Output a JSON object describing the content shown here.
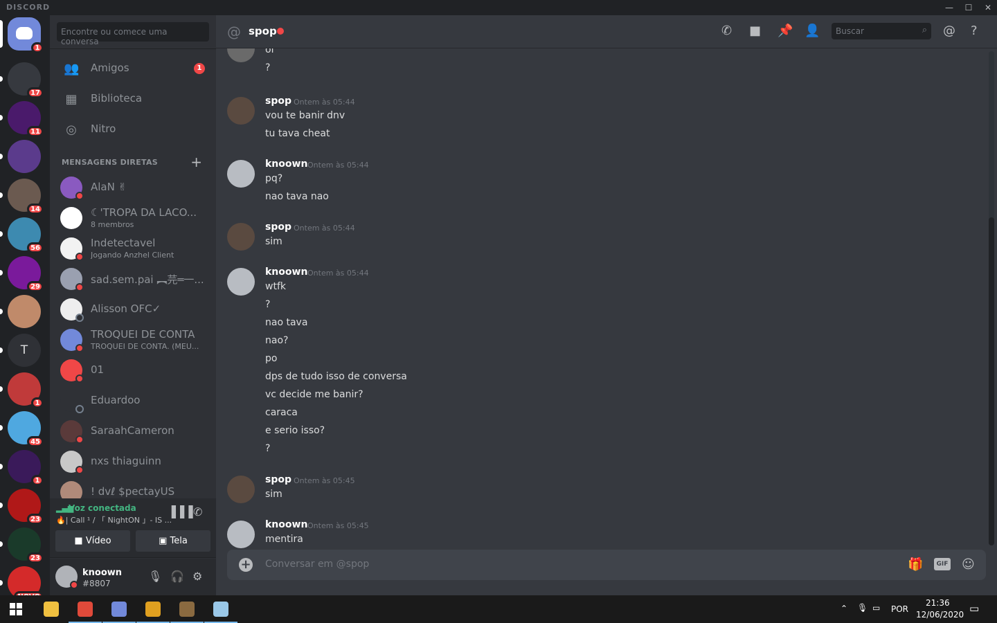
{
  "titlebar": {
    "brand": "DISCORD",
    "minimize": "—",
    "maximize": "☐",
    "close": "✕"
  },
  "guilds": {
    "home_badge": "1",
    "items": [
      {
        "badge": "17",
        "color": "#36393f"
      },
      {
        "badge": "11",
        "color": "#4a1a6b"
      },
      {
        "badge": "",
        "color": "#5b3b8c"
      },
      {
        "badge": "14",
        "color": "#6b5a50"
      },
      {
        "badge": "56",
        "color": "#3d8ab0"
      },
      {
        "badge": "29",
        "color": "#7a1a9b"
      },
      {
        "badge": "",
        "color": "#c08a6a"
      },
      {
        "badge": "",
        "color": "#2f3136",
        "letter": "T"
      },
      {
        "badge": "1",
        "color": "#c03a3a"
      },
      {
        "badge": "45",
        "color": "#4fa8e0"
      },
      {
        "badge": "1",
        "color": "#3a1a5a"
      },
      {
        "badge": "23",
        "color": "#b01818"
      },
      {
        "badge": "23",
        "color": "#1a3a2a"
      },
      {
        "badge": "NOVO",
        "color": "#d42a2a"
      }
    ]
  },
  "dmlist": {
    "search_placeholder": "Encontre ou comece uma conversa",
    "nav": [
      {
        "label": "Amigos",
        "icon": "👥",
        "badge": "1"
      },
      {
        "label": "Biblioteca",
        "icon": "▦",
        "badge": ""
      },
      {
        "label": "Nitro",
        "icon": "◎",
        "badge": ""
      }
    ],
    "header": "MENSAGENS DIRETAS",
    "add": "+",
    "dms": [
      {
        "name": "AlaN ✌",
        "sub": "",
        "color": "#8a5ac0",
        "status": "dnd"
      },
      {
        "name": "☾'TROPA DA LACO...",
        "sub": "8 membros",
        "color": "#ffffff",
        "status": ""
      },
      {
        "name": "Indetectavel",
        "sub": "Jogando Anzhel Client",
        "color": "#f2f2f2",
        "status": "dnd"
      },
      {
        "name": "sad.sem.pai ︻芫═一...",
        "sub": "",
        "color": "#9aa0b0",
        "status": "dnd"
      },
      {
        "name": "Alisson OFC✓",
        "sub": "",
        "color": "#eeeeee",
        "status": "offline"
      },
      {
        "name": "TROQUEI DE CONTA",
        "sub": "TROQUEI DE CONTA. (MEU...",
        "color": "#7289da",
        "status": "dnd"
      },
      {
        "name": "01",
        "sub": "",
        "color": "#f04747",
        "status": "dnd"
      },
      {
        "name": "Eduardoo",
        "sub": "",
        "color": "#2f3136",
        "status": "offline"
      },
      {
        "name": "SaraahCameron",
        "sub": "",
        "color": "#5a3a3a",
        "status": "dnd"
      },
      {
        "name": "nxs thiaguinn",
        "sub": "",
        "color": "#c8c8c8",
        "status": "dnd"
      },
      {
        "name": "! dvℓ $pectayUS",
        "sub": "",
        "color": "#b08a7a",
        "status": ""
      }
    ],
    "voice": {
      "title": "Voz conectada",
      "subtitle": "🔥| Call ¹ / 「 NightON 」- IS ...",
      "video": "Vídeo",
      "screen": "Tela"
    },
    "user": {
      "name": "knoown",
      "tag": "#8807"
    }
  },
  "chat": {
    "channel": "spop",
    "search_placeholder": "Buscar",
    "composer_placeholder": "Conversar em @spop",
    "gif": "GIF",
    "groups": [
      {
        "author": "",
        "time": "",
        "lines": [
          "oi",
          "?"
        ],
        "color": "#6a6a6a"
      },
      {
        "author": "spop",
        "time": "Ontem às 05:44",
        "lines": [
          "vou te banir dnv",
          "tu tava cheat"
        ],
        "color": "#5a4a40"
      },
      {
        "author": "knoown",
        "time": "Ontem às 05:44",
        "lines": [
          "pq?",
          "nao tava nao"
        ],
        "color": "#b8bcc2"
      },
      {
        "author": "spop",
        "time": "Ontem às 05:44",
        "lines": [
          "sim"
        ],
        "color": "#5a4a40"
      },
      {
        "author": "knoown",
        "time": "Ontem às 05:44",
        "lines": [
          "wtfk",
          "?",
          "nao tava",
          "nao?",
          "po",
          "dps de tudo isso de conversa",
          "vc decide me banir?",
          "caraca",
          "e serio isso?",
          "?"
        ],
        "color": "#b8bcc2"
      },
      {
        "author": "spop",
        "time": "Ontem às 05:45",
        "lines": [
          "sim"
        ],
        "color": "#5a4a40"
      },
      {
        "author": "knoown",
        "time": "Ontem às 05:45",
        "lines": [
          "mentira"
        ],
        "color": "#b8bcc2"
      }
    ]
  },
  "taskbar": {
    "lang": "POR",
    "time": "21:36",
    "date": "12/06/2020",
    "apps": [
      {
        "name": "file-explorer",
        "color": "#f0c040",
        "active": false
      },
      {
        "name": "chrome",
        "color": "#e04a3a",
        "active": true
      },
      {
        "name": "discord",
        "color": "#7289da",
        "active": true
      },
      {
        "name": "app-shield",
        "color": "#e0a020",
        "active": true
      },
      {
        "name": "minecraft",
        "color": "#8a6a40",
        "active": true
      },
      {
        "name": "notepad",
        "color": "#9ac8e8",
        "active": true
      }
    ]
  }
}
